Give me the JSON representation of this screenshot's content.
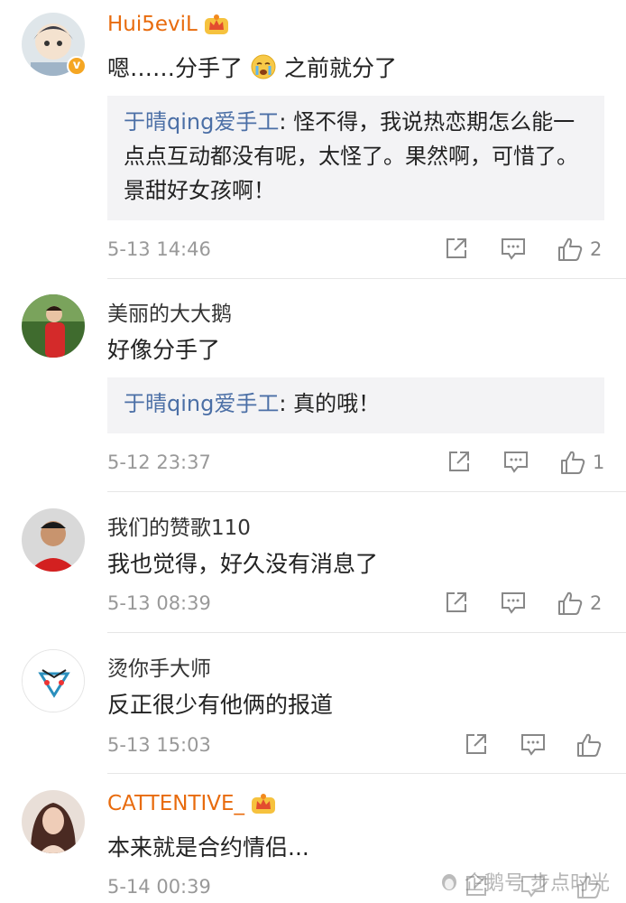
{
  "colors": {
    "vip_name": "#e86b0d",
    "reply_name": "#4b6fa6",
    "reply_bg": "#f3f3f5",
    "meta": "#999999"
  },
  "comments": [
    {
      "name": "Hui5eviL",
      "vip": true,
      "verified": true,
      "text_before": "嗯……分手了",
      "emoji": "crying-face",
      "text_after": "之前就分了",
      "reply_name": "于晴qing爱手工",
      "reply_text": ": 怪不得，我说热恋期怎么能一点点互动都没有呢，太怪了。果然啊，可惜了。景甜好女孩啊！",
      "time": "5-13 14:46",
      "likes": "2"
    },
    {
      "name": "美丽的大大鹅",
      "vip": false,
      "text": "好像分手了",
      "reply_name": "于晴qing爱手工",
      "reply_text": ": 真的哦！",
      "time": "5-12 23:37",
      "likes": "1"
    },
    {
      "name": "我们的赞歌110",
      "vip": false,
      "text": "我也觉得，好久没有消息了",
      "time": "5-13 08:39",
      "likes": "2"
    },
    {
      "name": "烫你手大师",
      "vip": false,
      "text": "反正很少有他俩的报道",
      "time": "5-13 15:03",
      "likes": ""
    },
    {
      "name": "CATTENTIVE_",
      "vip": true,
      "text": "本来就是合约情侣...",
      "time": "5-14 00:39",
      "likes": ""
    }
  ],
  "watermark": "企鹅号 步点时光",
  "badge_letter": "v"
}
